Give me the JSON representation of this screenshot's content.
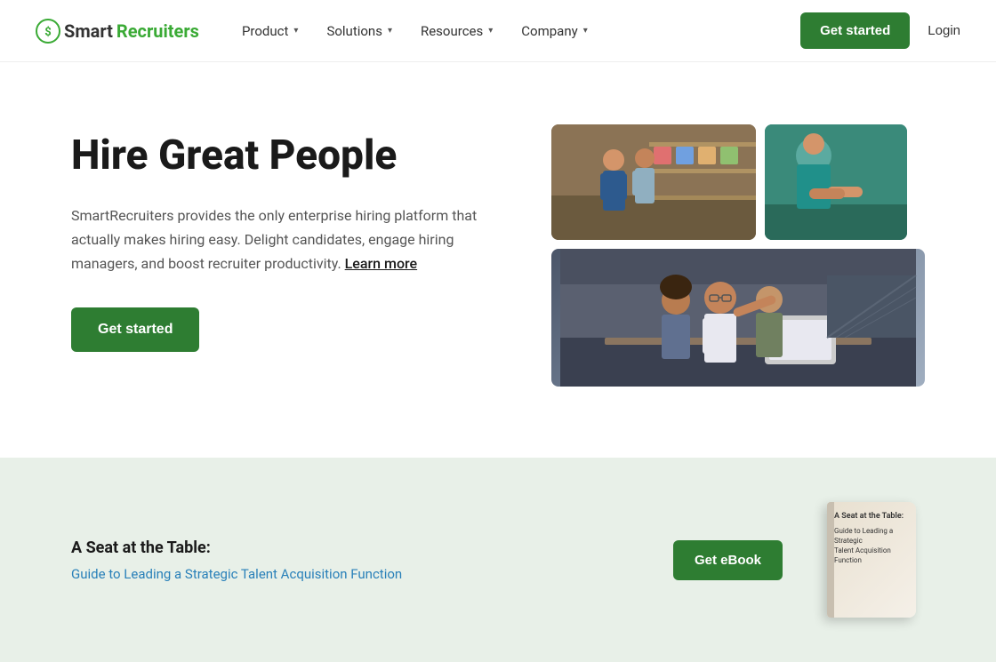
{
  "brand": {
    "logo_smart": "Smart",
    "logo_recruiters": "Recruiters",
    "logo_icon_symbol": "💲"
  },
  "navbar": {
    "product_label": "Product",
    "solutions_label": "Solutions",
    "resources_label": "Resources",
    "company_label": "Company",
    "get_started_label": "Get started",
    "login_label": "Login"
  },
  "hero": {
    "title": "Hire Great People",
    "description_part1": "SmartRecruiters provides the only enterprise hiring platform that actually makes hiring easy. Delight candidates, engage hiring managers, and boost recruiter productivity.",
    "learn_more_label": "Learn more",
    "get_started_label": "Get started"
  },
  "banner": {
    "title": "A Seat at the Table:",
    "subtitle": "Guide to Leading a Strategic Talent Acquisition Function",
    "cta_label": "Get eBook",
    "book_title_line1": "A Seat at the Table:",
    "book_title_line2": "Guide to Leading a Strategic",
    "book_title_line3": "Talent Acquisition Function"
  }
}
